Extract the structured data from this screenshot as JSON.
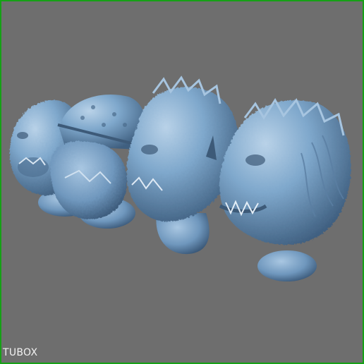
{
  "viewer": {
    "background_color": "#6e6e6e",
    "frame_color": "#16a016",
    "model_color": "#7aa6cc",
    "watermark": "TUBOX"
  },
  "model": {
    "kind": "3d-scan",
    "heads": [
      "bald-zombie-head",
      "helmet-zombie-head",
      "werewolf-head-1",
      "werewolf-head-2"
    ]
  }
}
